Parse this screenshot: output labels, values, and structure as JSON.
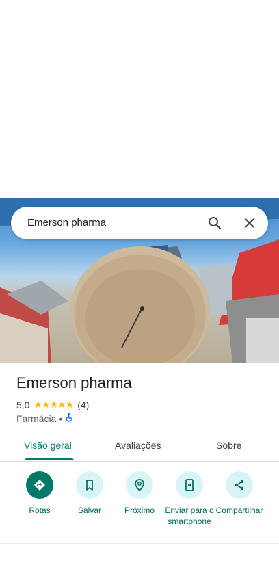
{
  "search": {
    "query": "Emerson pharma"
  },
  "place": {
    "name": "Emerson pharma",
    "rating": "5,0",
    "stars": "★★★★★",
    "review_count": "(4)",
    "category": "Farmácia",
    "separator": "•"
  },
  "tabs": [
    {
      "label": "Visão geral"
    },
    {
      "label": "Avaliações"
    },
    {
      "label": "Sobre"
    }
  ],
  "actions": [
    {
      "label": "Rotas"
    },
    {
      "label": "Salvar"
    },
    {
      "label": "Próximo"
    },
    {
      "label": "Enviar para o smartphone"
    },
    {
      "label": "Compartilhar"
    }
  ],
  "colors": {
    "accent": "#00796b",
    "star": "#f6b400",
    "chip_bg": "#d8f4f7"
  }
}
